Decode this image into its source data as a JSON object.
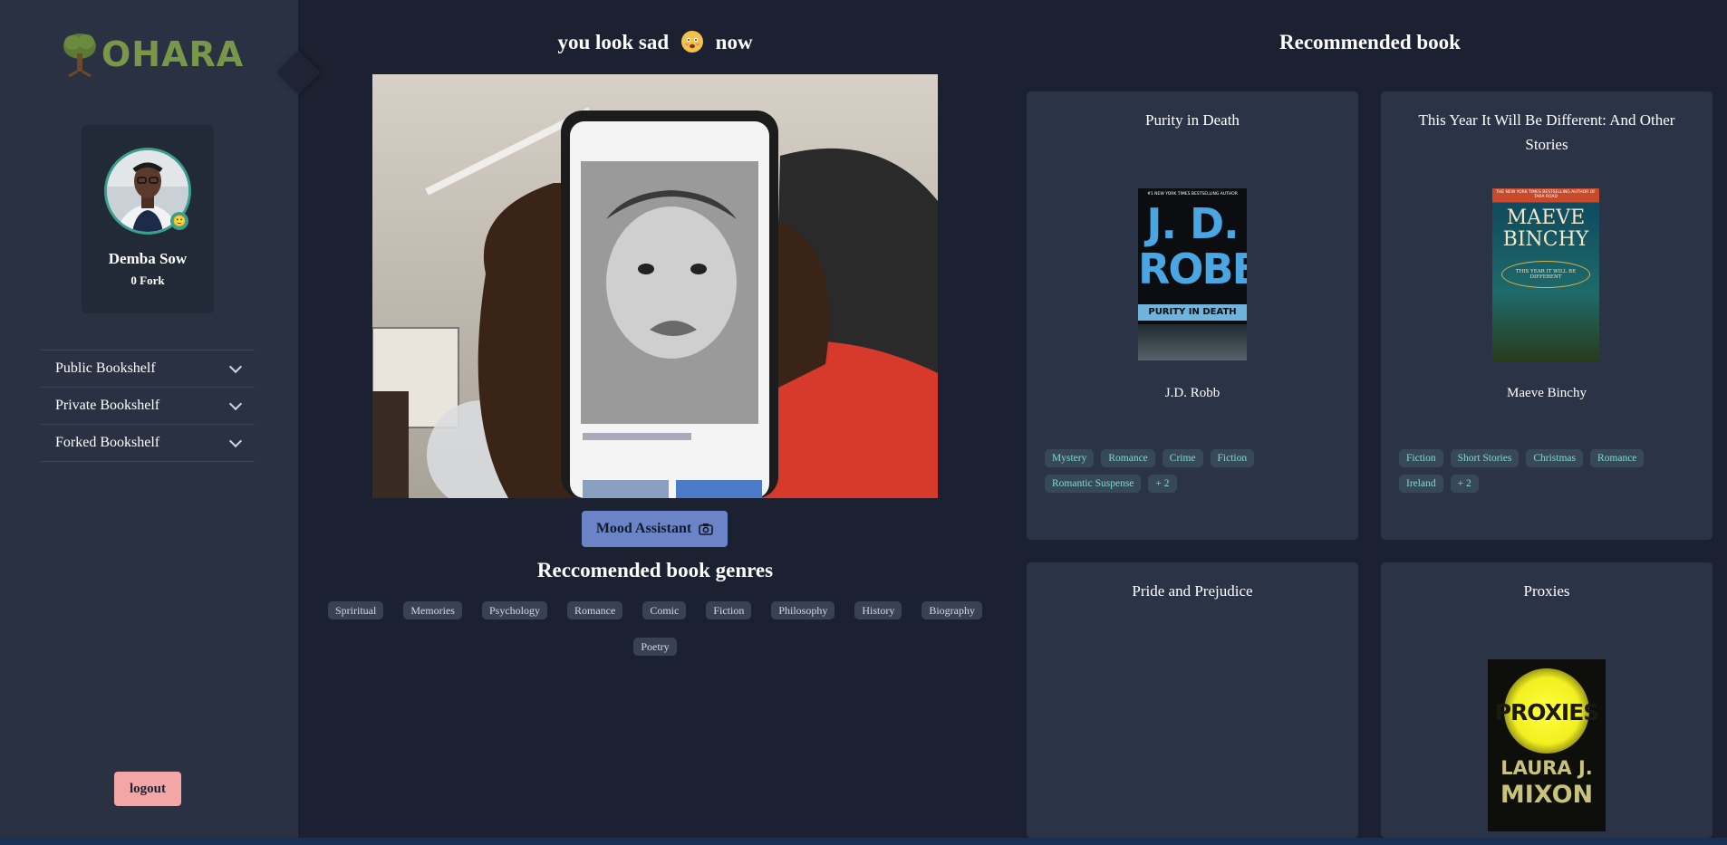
{
  "sidebar": {
    "logo_text": "OHARA",
    "profile": {
      "name": "Demba Sow",
      "forks": "0 Fork",
      "mood_emoji": "🙂"
    },
    "menu": [
      {
        "label": "Public Bookshelf"
      },
      {
        "label": "Private Bookshelf"
      },
      {
        "label": "Forked Bookshelf"
      }
    ],
    "logout_label": "logout"
  },
  "mood": {
    "prefix": "you look sad",
    "suffix": "now",
    "button_label": "Mood Assistant"
  },
  "genres": {
    "title": "Reccomended book genres",
    "items": [
      "Spriritual",
      "Memories",
      "Psychology",
      "Romance",
      "Comic",
      "Fiction",
      "Philosophy",
      "History",
      "Biography",
      "Poetry"
    ]
  },
  "recommendations": {
    "title": "Recommended book",
    "books": [
      {
        "title": "Purity in Death",
        "author": "J.D. Robb",
        "cover_lines": [
          "#1 NEW YORK TIMES BESTSELLING AUTHOR",
          "J. D.",
          "ROBB",
          "PURITY IN DEATH"
        ],
        "tags": [
          "Mystery",
          "Romance",
          "Crime",
          "Fiction",
          "Romantic Suspense",
          "+ 2"
        ]
      },
      {
        "title": "This Year It Will Be Different: And Other Stories",
        "author": "Maeve Binchy",
        "cover_lines": [
          "THE NEW YORK TIMES BESTSELLING AUTHOR OF TARA ROAD",
          "MAEVE",
          "BINCHY",
          "THIS YEAR IT WILL BE DIFFERENT"
        ],
        "tags": [
          "Fiction",
          "Short Stories",
          "Christmas",
          "Romance",
          "Ireland",
          "+ 2"
        ]
      },
      {
        "title": "Pride and Prejudice",
        "author": "",
        "tags": []
      },
      {
        "title": "Proxies",
        "author": "",
        "cover_lines": [
          "PROXIES",
          "LAURA J.",
          "MIXON"
        ],
        "tags": []
      }
    ]
  },
  "colors": {
    "accent": "#3a9f8e",
    "logo_green": "#78974b",
    "button_blue": "#6a84c7",
    "logout_pink": "#f4a5a6",
    "tag_text": "#7fdcc9"
  }
}
